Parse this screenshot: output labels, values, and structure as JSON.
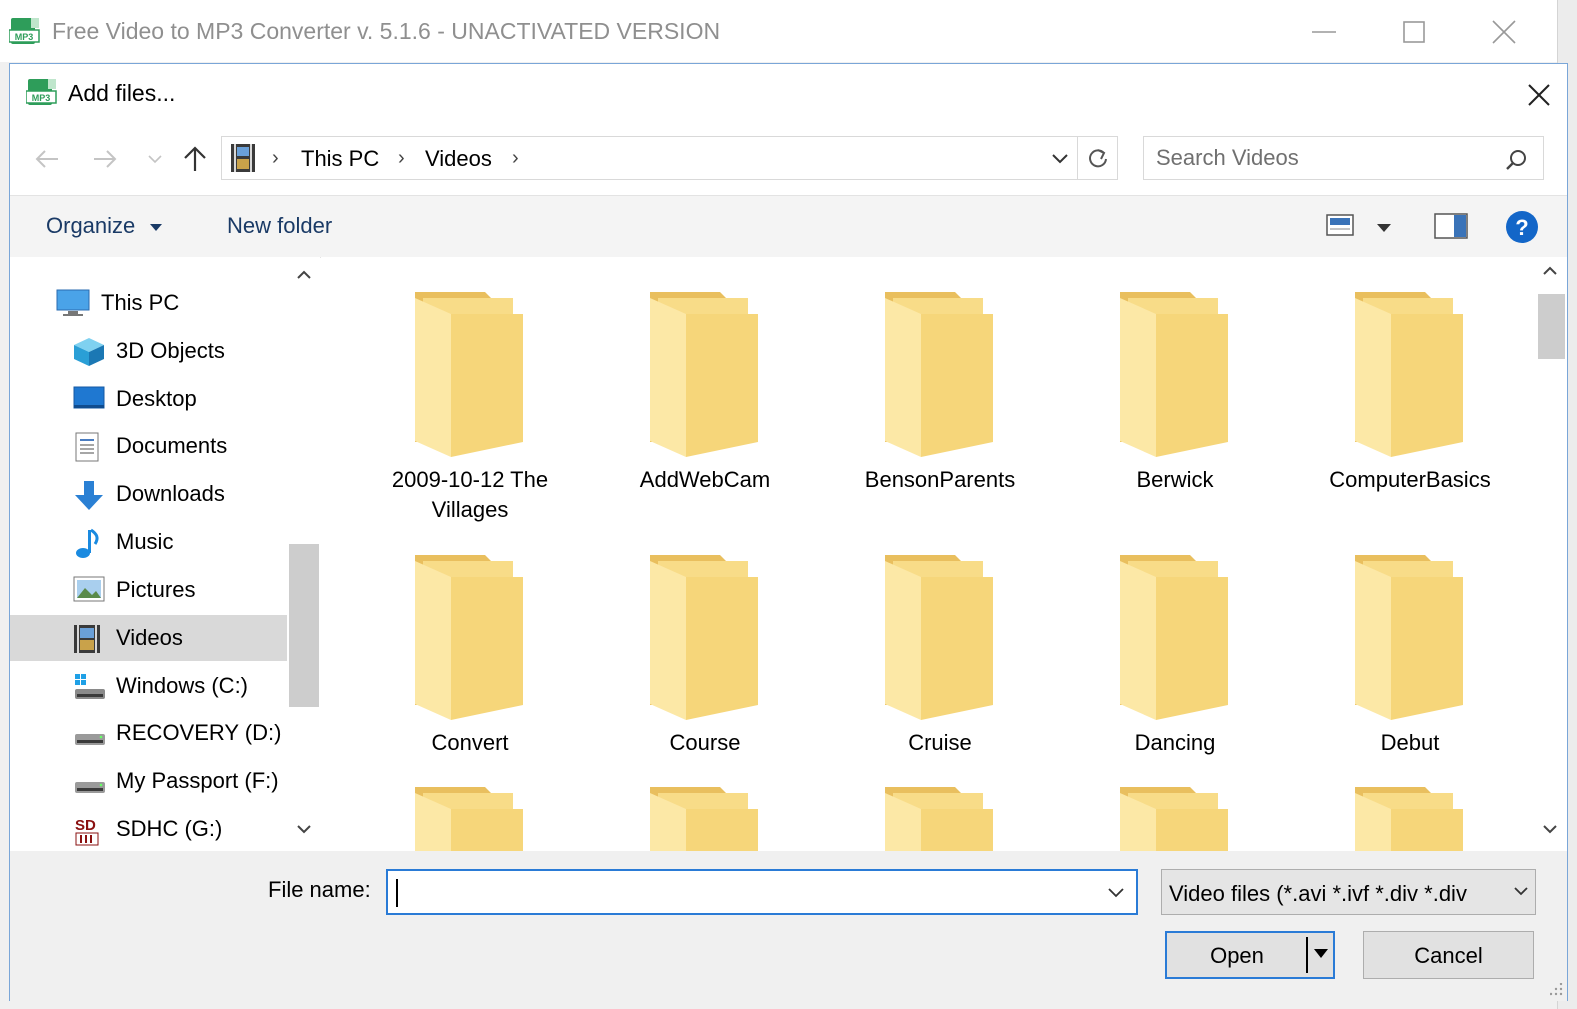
{
  "app": {
    "title": "Free Video to MP3 Converter v. 5.1.6 - UNACTIVATED VERSION",
    "icon": "mp3-app-icon"
  },
  "dialog": {
    "title": "Add files...",
    "address": {
      "crumbs": [
        "This PC",
        "Videos"
      ],
      "icon": "videos-folder-icon"
    },
    "search": {
      "placeholder": "Search Videos"
    },
    "toolbar": {
      "organize_label": "Organize",
      "new_folder_label": "New folder"
    },
    "nav_pane": {
      "items": [
        {
          "label": "This PC",
          "icon": "computer-icon",
          "selected": false
        },
        {
          "label": "3D Objects",
          "icon": "3d-objects-icon",
          "selected": false
        },
        {
          "label": "Desktop",
          "icon": "desktop-icon",
          "selected": false
        },
        {
          "label": "Documents",
          "icon": "documents-icon",
          "selected": false
        },
        {
          "label": "Downloads",
          "icon": "downloads-icon",
          "selected": false
        },
        {
          "label": "Music",
          "icon": "music-icon",
          "selected": false
        },
        {
          "label": "Pictures",
          "icon": "pictures-icon",
          "selected": false
        },
        {
          "label": "Videos",
          "icon": "videos-icon",
          "selected": true
        },
        {
          "label": "Windows (C:)",
          "icon": "windows-drive-icon",
          "selected": false
        },
        {
          "label": "RECOVERY (D:)",
          "icon": "drive-icon",
          "selected": false
        },
        {
          "label": "My Passport (F:)",
          "icon": "drive-icon",
          "selected": false
        },
        {
          "label": "SDHC (G:)",
          "icon": "sd-card-icon",
          "selected": false
        }
      ]
    },
    "folders": [
      "2009-10-12 The Villages",
      "AddWebCam",
      "BensonParents",
      "Berwick",
      "ComputerBasics",
      "Convert",
      "Course",
      "Cruise",
      "Dancing",
      "Debut",
      "",
      "",
      "",
      "",
      ""
    ],
    "file_name": {
      "label": "File name:",
      "value": ""
    },
    "file_type": {
      "selected": "Video files (*.avi *.ivf *.div *.div"
    },
    "buttons": {
      "open": "Open",
      "cancel": "Cancel"
    }
  },
  "colors": {
    "accent": "#2a7bd6",
    "folder": "#f6d67a",
    "selected_nav": "#d9d9d9",
    "help_icon": "#1366c8"
  }
}
